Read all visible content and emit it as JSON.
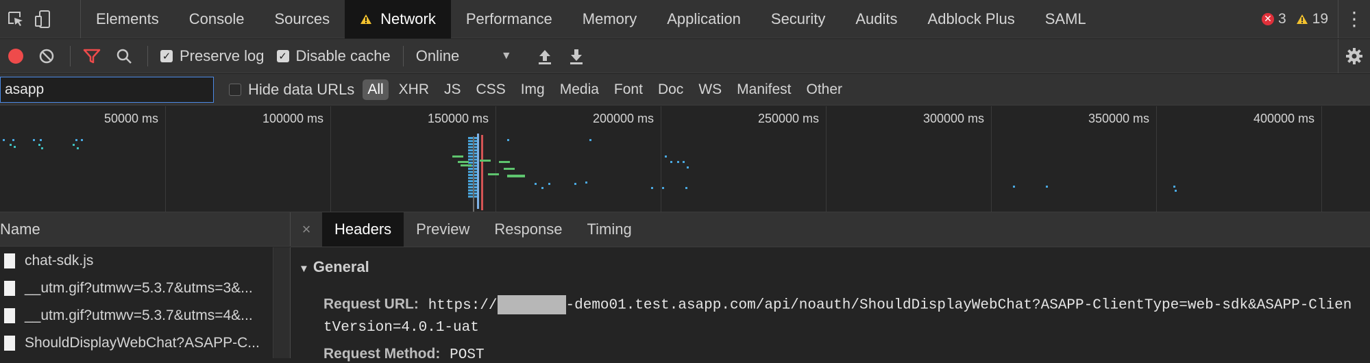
{
  "tabs": [
    {
      "label": "Elements"
    },
    {
      "label": "Console"
    },
    {
      "label": "Sources"
    },
    {
      "label": "Network",
      "active": true,
      "warning": true
    },
    {
      "label": "Performance"
    },
    {
      "label": "Memory"
    },
    {
      "label": "Application"
    },
    {
      "label": "Security"
    },
    {
      "label": "Audits"
    },
    {
      "label": "Adblock Plus"
    },
    {
      "label": "SAML"
    }
  ],
  "issues": {
    "errors": "3",
    "warnings": "19"
  },
  "toolbar": {
    "preserve_log": {
      "label": "Preserve log",
      "checked": true
    },
    "disable_cache": {
      "label": "Disable cache",
      "checked": true
    },
    "throttling": "Online"
  },
  "filter": {
    "value": "asapp",
    "hide_data_urls": {
      "label": "Hide data URLs",
      "checked": false
    },
    "types": [
      "All",
      "XHR",
      "JS",
      "CSS",
      "Img",
      "Media",
      "Font",
      "Doc",
      "WS",
      "Manifest",
      "Other"
    ],
    "active_type": "All"
  },
  "overview": {
    "labels": [
      "50000 ms",
      "100000 ms",
      "150000 ms",
      "200000 ms",
      "250000 ms",
      "300000 ms",
      "350000 ms",
      "400000 ms"
    ]
  },
  "requests": {
    "header": "Name",
    "items": [
      {
        "name": "chat-sdk.js"
      },
      {
        "name": "__utm.gif?utmwv=5.3.7&utms=3&..."
      },
      {
        "name": "__utm.gif?utmwv=5.3.7&utms=4&..."
      },
      {
        "name": "ShouldDisplayWebChat?ASAPP-C..."
      }
    ]
  },
  "detail": {
    "close": "×",
    "tabs": [
      "Headers",
      "Preview",
      "Response",
      "Timing"
    ],
    "active_tab": "Headers",
    "section": "General",
    "request_url_label": "Request URL:",
    "request_url_prefix": "https://",
    "request_url_rest": "-demo01.test.asapp.com/api/noauth/ShouldDisplayWebChat?ASAPP-ClientType=web-sdk&ASAPP-Clien",
    "request_url_cont": "tVersion=4.0.1-uat",
    "request_method_label": "Request Method:",
    "request_method": "POST"
  },
  "colors": {
    "accent": "#4c8ae6",
    "record": "#ee4b4b",
    "bg": "#242424",
    "toolbar": "#333333"
  }
}
